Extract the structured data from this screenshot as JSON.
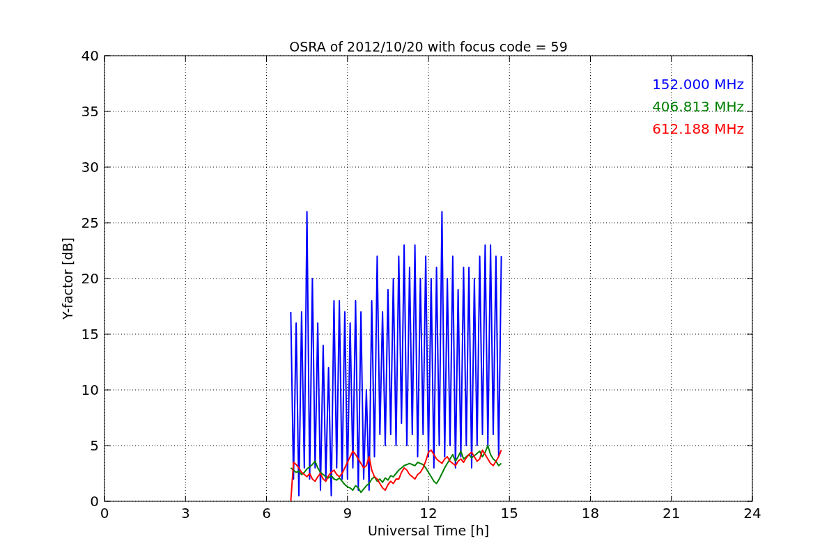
{
  "chart_data": {
    "type": "line",
    "title": "OSRA of 2012/10/20 with focus code = 59",
    "xlabel": "Universal Time [h]",
    "ylabel": "Y-factor [dB]",
    "x": [
      6.9,
      7.0,
      7.1,
      7.2,
      7.3,
      7.4,
      7.5,
      7.6,
      7.7,
      7.8,
      7.9,
      8.0,
      8.1,
      8.2,
      8.3,
      8.4,
      8.5,
      8.6,
      8.7,
      8.8,
      8.9,
      9.0,
      9.1,
      9.2,
      9.3,
      9.4,
      9.5,
      9.6,
      9.7,
      9.8,
      9.9,
      10.0,
      10.1,
      10.2,
      10.3,
      10.4,
      10.5,
      10.6,
      10.7,
      10.8,
      10.9,
      11.0,
      11.1,
      11.2,
      11.3,
      11.4,
      11.5,
      11.6,
      11.7,
      11.8,
      11.9,
      12.0,
      12.1,
      12.2,
      12.3,
      12.4,
      12.5,
      12.6,
      12.7,
      12.8,
      12.9,
      13.0,
      13.1,
      13.2,
      13.3,
      13.4,
      13.5,
      13.6,
      13.7,
      13.8,
      13.9,
      14.0,
      14.1,
      14.2,
      14.3,
      14.4,
      14.5,
      14.6,
      14.7
    ],
    "series": [
      {
        "name": "152.000 MHz",
        "color": "#0000ff",
        "values": [
          17,
          2,
          16,
          0.5,
          17,
          3,
          26,
          2,
          20,
          3,
          16,
          1,
          14,
          2,
          12,
          0.5,
          18,
          3,
          18,
          2,
          17,
          2,
          16,
          3,
          18,
          1,
          17,
          2,
          10,
          1,
          18,
          4,
          22,
          6,
          17,
          5,
          19,
          6,
          20,
          5,
          22,
          7,
          23,
          5,
          21,
          6,
          23,
          4,
          20,
          6,
          22,
          4,
          20,
          3,
          21,
          5,
          26,
          4,
          20,
          5,
          22,
          3,
          19,
          4,
          21,
          5,
          21,
          3,
          20,
          5,
          22,
          6,
          23,
          5,
          23,
          6,
          22,
          4,
          22
        ]
      },
      {
        "name": "406.813 MHz",
        "color": "#008000",
        "values": [
          3.0,
          2.8,
          2.6,
          2.7,
          2.4,
          2.6,
          2.9,
          3.1,
          3.3,
          3.6,
          3.0,
          2.6,
          2.4,
          2.2,
          2.1,
          2.3,
          2.0,
          1.9,
          2.1,
          1.8,
          1.5,
          1.3,
          1.2,
          1.0,
          1.4,
          1.2,
          0.8,
          1.1,
          1.4,
          1.6,
          2.0,
          2.2,
          1.8,
          2.0,
          1.7,
          2.1,
          1.9,
          2.3,
          2.2,
          2.5,
          2.8,
          3.0,
          3.2,
          3.3,
          3.4,
          3.3,
          3.2,
          3.5,
          3.4,
          3.3,
          3.0,
          2.6,
          2.2,
          1.8,
          1.6,
          2.0,
          2.5,
          3.0,
          3.4,
          3.8,
          4.2,
          3.6,
          4.0,
          4.5,
          3.8,
          4.0,
          4.2,
          3.9,
          4.1,
          4.3,
          4.5,
          4.0,
          4.4,
          5.0,
          4.2,
          3.8,
          3.6,
          3.2,
          3.4
        ]
      },
      {
        "name": "612.188 MHz",
        "color": "#ff0000",
        "values": [
          0,
          3.5,
          3.3,
          3.0,
          2.6,
          2.4,
          2.2,
          2.5,
          2.0,
          1.8,
          2.2,
          2.5,
          2.0,
          1.8,
          2.3,
          2.6,
          2.8,
          2.4,
          2.2,
          2.5,
          3.0,
          3.5,
          4.0,
          4.5,
          4.2,
          3.8,
          3.4,
          3.0,
          3.2,
          4.0,
          2.8,
          2.2,
          2.0,
          1.6,
          1.2,
          1.0,
          1.5,
          1.8,
          1.6,
          2.0,
          2.0,
          2.6,
          3.0,
          2.8,
          2.4,
          2.2,
          2.0,
          2.4,
          2.6,
          3.0,
          3.6,
          4.4,
          4.6,
          4.2,
          3.8,
          3.6,
          3.4,
          3.8,
          4.0,
          3.6,
          3.4,
          3.2,
          3.6,
          3.8,
          3.5,
          3.9,
          4.2,
          4.4,
          4.0,
          3.6,
          3.8,
          4.6,
          4.2,
          3.8,
          3.4,
          3.2,
          3.6,
          4.0,
          4.6
        ]
      }
    ],
    "grid": true,
    "xlim": [
      0,
      24
    ],
    "ylim": [
      0,
      40
    ],
    "xticks": [
      0,
      3,
      6,
      9,
      12,
      15,
      18,
      21,
      24
    ],
    "yticks": [
      0,
      5,
      10,
      15,
      20,
      25,
      30,
      35,
      40
    ]
  }
}
